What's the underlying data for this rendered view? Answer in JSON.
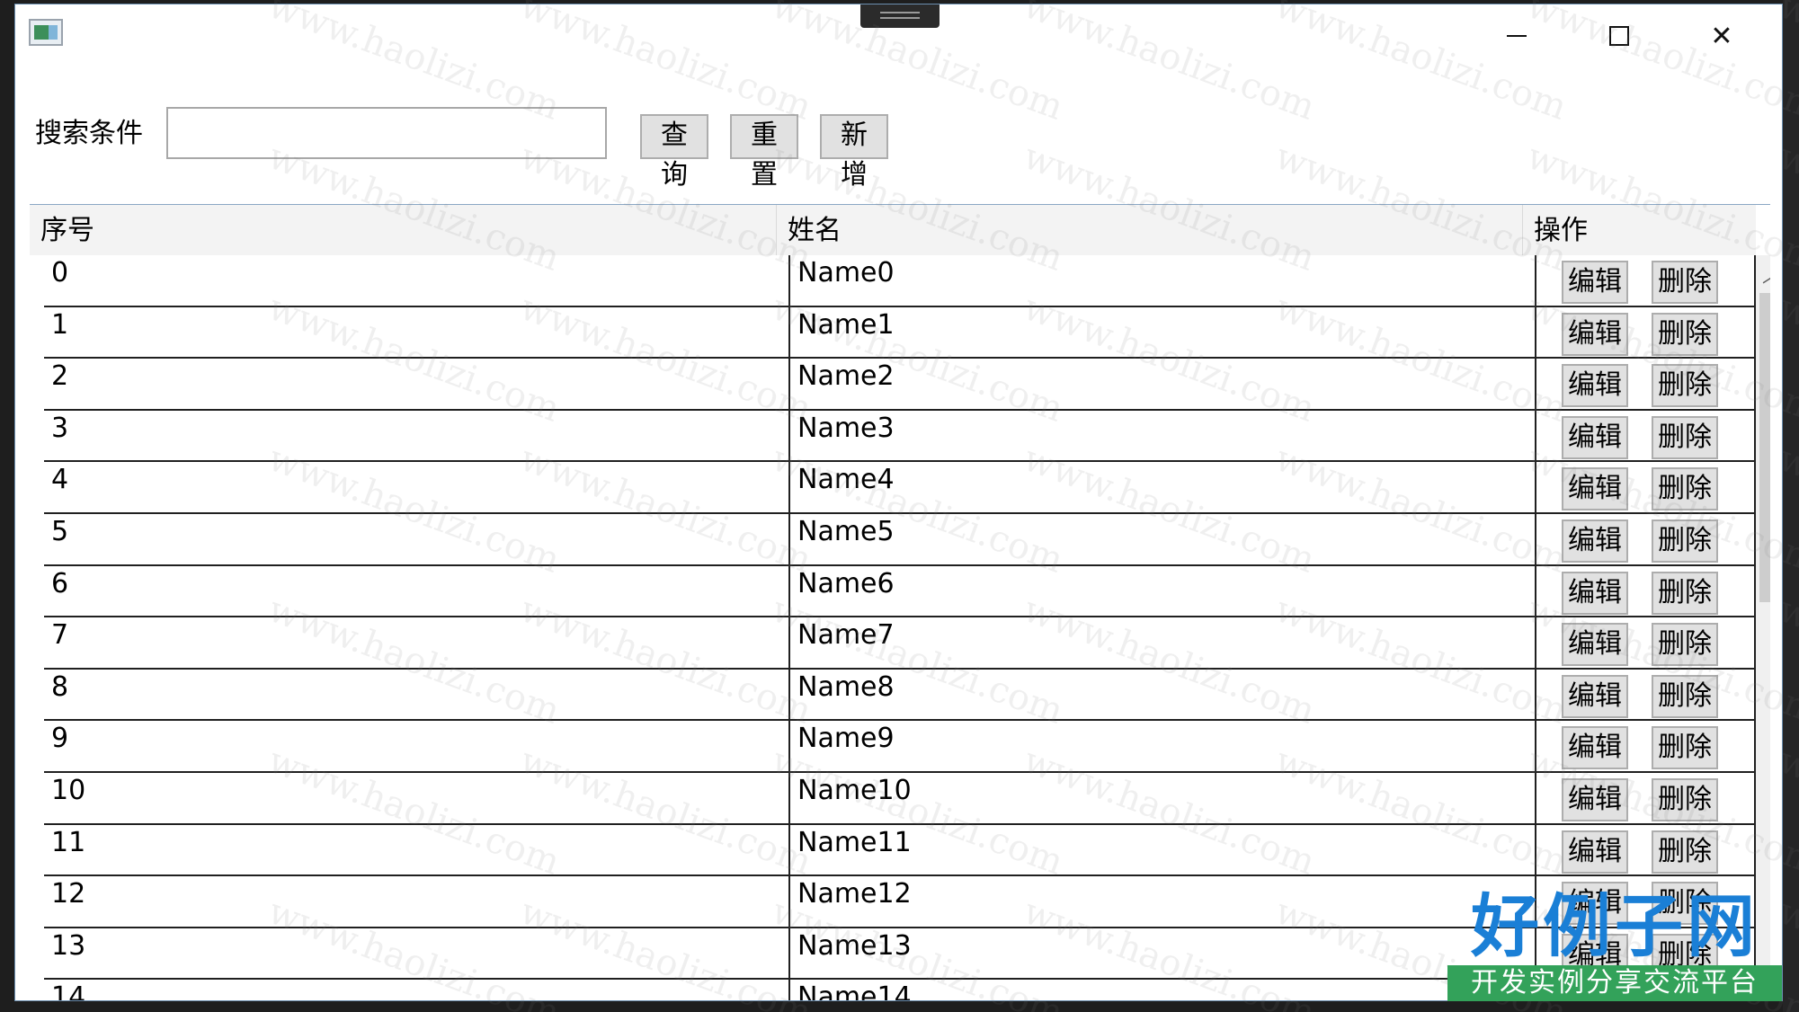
{
  "window": {
    "min_icon": "minimize-icon",
    "max_icon": "maximize-icon",
    "close_icon": "close-icon",
    "close_glyph": "✕"
  },
  "toolbar": {
    "search_label": "搜索条件",
    "search_value": "",
    "query_label": "查询",
    "reset_label": "重置",
    "add_label": "新增"
  },
  "grid": {
    "columns": [
      "序号",
      "姓名",
      "操作"
    ],
    "edit_label": "编辑",
    "delete_label": "删除",
    "rows": [
      {
        "id": "0",
        "name": "Name0"
      },
      {
        "id": "1",
        "name": "Name1"
      },
      {
        "id": "2",
        "name": "Name2"
      },
      {
        "id": "3",
        "name": "Name3"
      },
      {
        "id": "4",
        "name": "Name4"
      },
      {
        "id": "5",
        "name": "Name5"
      },
      {
        "id": "6",
        "name": "Name6"
      },
      {
        "id": "7",
        "name": "Name7"
      },
      {
        "id": "8",
        "name": "Name8"
      },
      {
        "id": "9",
        "name": "Name9"
      },
      {
        "id": "10",
        "name": "Name10"
      },
      {
        "id": "11",
        "name": "Name11"
      },
      {
        "id": "12",
        "name": "Name12"
      },
      {
        "id": "13",
        "name": "Name13"
      },
      {
        "id": "14",
        "name": "Name14"
      }
    ]
  },
  "watermark": "www.haolizi.com",
  "logo": {
    "main": "好例子网",
    "sub": "开发实例分享交流平台"
  },
  "colors": {
    "logo_blue": "#1a7fd6",
    "logo_green": "#33a25a",
    "window_border": "#6c8fb0"
  }
}
